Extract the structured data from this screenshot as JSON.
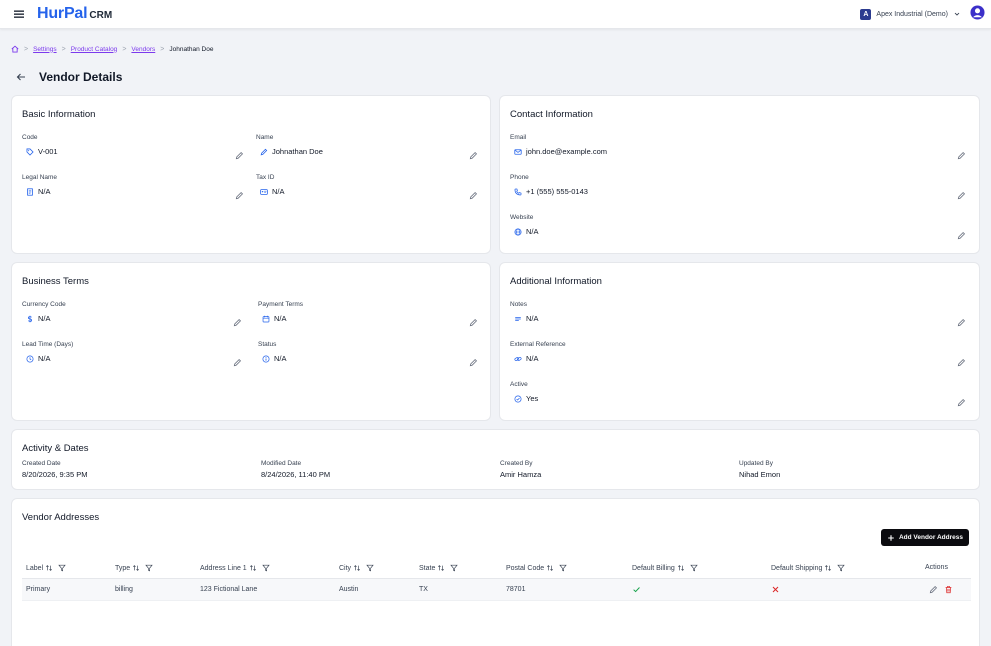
{
  "header": {
    "logo_main": "HurPal",
    "logo_sub": "CRM",
    "company_initial": "A",
    "company_name": "Apex Industrial (Demo)"
  },
  "breadcrumb": {
    "items": [
      "Settings",
      "Product Catalog",
      "Vendors"
    ],
    "current": "Johnathan Doe",
    "separator": ">"
  },
  "page": {
    "title": "Vendor Details"
  },
  "basic_info": {
    "title": "Basic Information",
    "code": {
      "label": "Code",
      "value": "V-001",
      "icon": "tag-icon"
    },
    "name": {
      "label": "Name",
      "value": "Johnathan Doe",
      "icon": "pencil-icon"
    },
    "legal_name": {
      "label": "Legal Name",
      "value": "N/A",
      "icon": "document-icon"
    },
    "tax_id": {
      "label": "Tax ID",
      "value": "N/A",
      "icon": "id-card-icon"
    }
  },
  "contact_info": {
    "title": "Contact Information",
    "email": {
      "label": "Email",
      "value": "john.doe@example.com",
      "icon": "mail-icon"
    },
    "phone": {
      "label": "Phone",
      "value": "+1 (555) 555-0143",
      "icon": "phone-icon"
    },
    "website": {
      "label": "Website",
      "value": "N/A",
      "icon": "globe-icon"
    }
  },
  "business_terms": {
    "title": "Business Terms",
    "currency_code": {
      "label": "Currency Code",
      "value": "N/A",
      "icon": "dollar-icon"
    },
    "payment_terms": {
      "label": "Payment Terms",
      "value": "N/A",
      "icon": "calendar-icon"
    },
    "lead_time": {
      "label": "Lead Time (Days)",
      "value": "N/A",
      "icon": "clock-icon"
    },
    "status": {
      "label": "Status",
      "value": "N/A",
      "icon": "info-icon"
    }
  },
  "additional_info": {
    "title": "Additional Information",
    "notes": {
      "label": "Notes",
      "value": "N/A",
      "icon": "lines-icon"
    },
    "external_reference": {
      "label": "External Reference",
      "value": "N/A",
      "icon": "link-icon"
    },
    "active": {
      "label": "Active",
      "value": "Yes",
      "icon": "check-circle-icon"
    }
  },
  "activity": {
    "title": "Activity & Dates",
    "created_date": {
      "label": "Created Date",
      "value": "8/20/2026, 9:35 PM"
    },
    "modified_date": {
      "label": "Modified Date",
      "value": "8/24/2026, 11:40 PM"
    },
    "created_by": {
      "label": "Created By",
      "value": "Amir Hamza"
    },
    "updated_by": {
      "label": "Updated By",
      "value": "Nihad Emon"
    }
  },
  "addresses": {
    "title": "Vendor Addresses",
    "add_button": "Add Vendor Address",
    "columns": [
      "Label",
      "Type",
      "Address Line 1",
      "City",
      "State",
      "Postal Code",
      "Default Billing",
      "Default Shipping",
      "Actions"
    ],
    "rows": [
      {
        "label": "Primary",
        "type": "billing",
        "address_line_1": "123 Fictional Lane",
        "city": "Austin",
        "state": "TX",
        "postal_code": "78701",
        "default_billing": true,
        "default_shipping": false
      }
    ]
  },
  "colors": {
    "brand": "#2563eb",
    "link": "#7c3aed",
    "check": "#16a34a",
    "cross": "#dc2626",
    "button": "#0b0b0f"
  }
}
